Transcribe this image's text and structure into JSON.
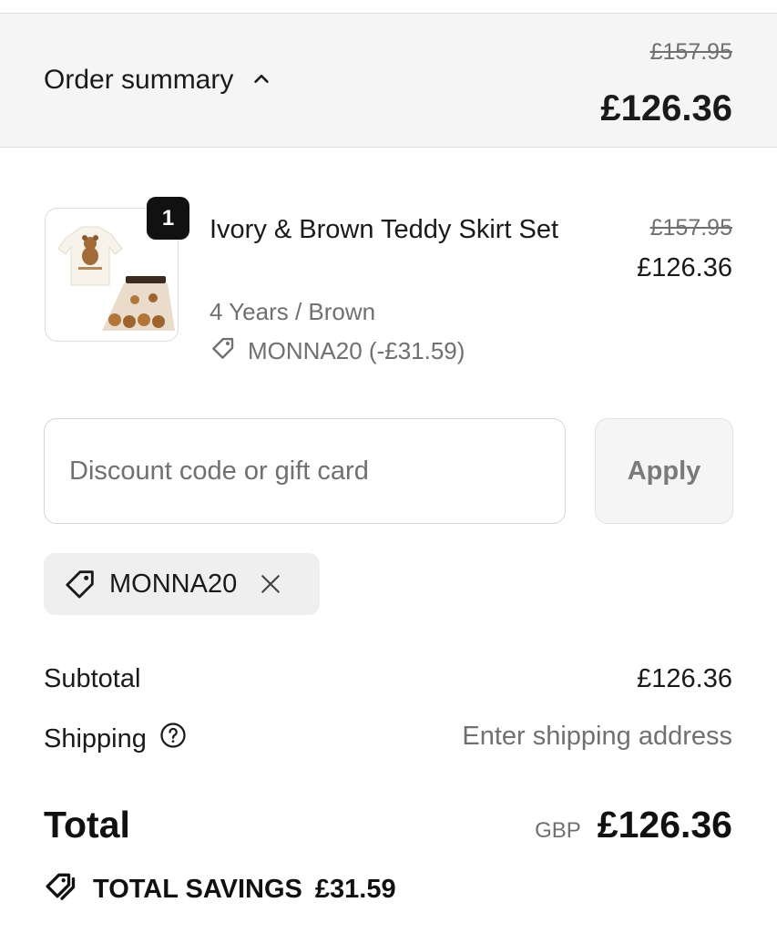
{
  "summary": {
    "toggle_label": "Order summary",
    "original_total": "£157.95",
    "discounted_total": "£126.36"
  },
  "product": {
    "quantity": "1",
    "name": "Ivory & Brown Teddy Skirt Set",
    "variant": "4 Years / Brown",
    "discount_line": "MONNA20 (-£31.59)",
    "original_price": "£157.95",
    "price": "£126.36",
    "image_alt": "Ivory & Brown Teddy Skirt Set"
  },
  "discount": {
    "placeholder": "Discount code or gift card",
    "value": "",
    "apply_label": "Apply",
    "applied_code": "MONNA20"
  },
  "totals": {
    "subtotal_label": "Subtotal",
    "subtotal_value": "£126.36",
    "shipping_label": "Shipping",
    "shipping_value": "Enter shipping address",
    "total_label": "Total",
    "currency": "GBP",
    "total_value": "£126.36",
    "savings_label": "TOTAL SAVINGS",
    "savings_value": "£31.59"
  },
  "icons": {
    "toggle": "chevron-up-icon",
    "tag": "tag-icon",
    "remove": "close-icon",
    "help": "question-circle-icon",
    "savings": "tags-icon"
  },
  "colors": {
    "bar_background": "#f5f5f5",
    "muted_text": "#707070",
    "text": "#1a1a1a",
    "badge": "#111111"
  }
}
